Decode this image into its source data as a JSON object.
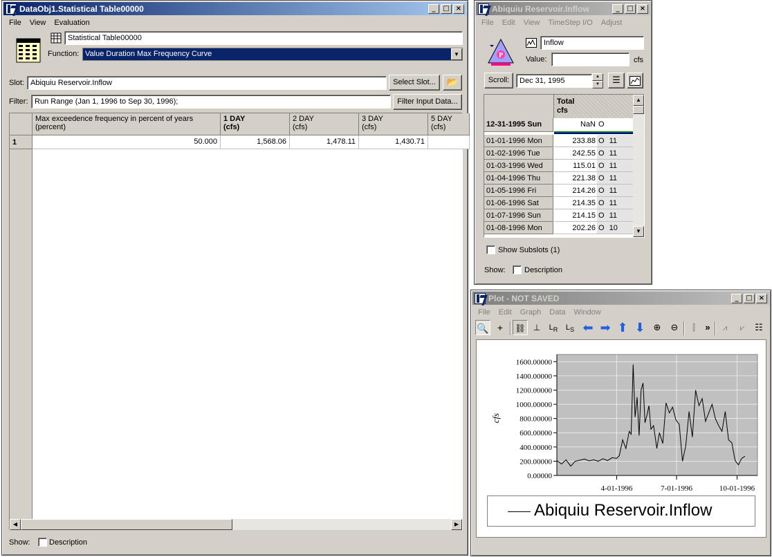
{
  "stat_window": {
    "title": "DataObj1.Statistical Table00000",
    "menu": [
      "File",
      "View",
      "Evaluation"
    ],
    "name_value": "Statistical Table00000",
    "function_label": "Function:",
    "function_value": "Value Duration Max Frequency Curve",
    "slot_label": "Slot:",
    "slot_value": "Abiquiu Reservoir.Inflow",
    "select_slot_label": "Select Slot...",
    "filter_label": "Filter:",
    "filter_value": "Run Range (Jan 1, 1996 to Sep 30, 1996);",
    "filter_button_label": "Filter Input Data...",
    "table": {
      "headers": [
        {
          "line1": "Max exceedence frequency in percent of years",
          "line2": "(percent)"
        },
        {
          "line1": "1 DAY",
          "line2": "(cfs)"
        },
        {
          "line1": "2 DAY",
          "line2": "(cfs)"
        },
        {
          "line1": "3 DAY",
          "line2": "(cfs)"
        },
        {
          "line1": "5 DAY",
          "line2": "(cfs)"
        }
      ],
      "row_number": "1",
      "row_values": [
        "50.000",
        "1,568.06",
        "1,478.11",
        "1,430.71",
        ""
      ]
    },
    "show_label": "Show:",
    "description_label": "Description"
  },
  "slot_window": {
    "title": "Abiquiu Reservoir.Inflow",
    "menu": [
      "File",
      "Edit",
      "View",
      "TimeStep I/O",
      "Adjust"
    ],
    "slot_name": "Inflow",
    "value_label": "Value:",
    "value_input": "",
    "units": "cfs",
    "scroll_label": "Scroll:",
    "scroll_date": "Dec 31, 1995",
    "column_header": {
      "line1": "Total",
      "line2": "cfs"
    },
    "initial_row": {
      "date": "12-31-1995 Sun",
      "value": "NaN",
      "flag": "O",
      "extra": ""
    },
    "rows": [
      {
        "date": "01-01-1996 Mon",
        "value": "233.88",
        "flag": "O",
        "extra": "11"
      },
      {
        "date": "01-02-1996 Tue",
        "value": "242.55",
        "flag": "O",
        "extra": "11"
      },
      {
        "date": "01-03-1996 Wed",
        "value": "115.01",
        "flag": "O",
        "extra": "11"
      },
      {
        "date": "01-04-1996 Thu",
        "value": "221.38",
        "flag": "O",
        "extra": "11"
      },
      {
        "date": "01-05-1996 Fri",
        "value": "214.26",
        "flag": "O",
        "extra": "11"
      },
      {
        "date": "01-06-1996 Sat",
        "value": "214.35",
        "flag": "O",
        "extra": "11"
      },
      {
        "date": "01-07-1996 Sun",
        "value": "214.15",
        "flag": "O",
        "extra": "11"
      },
      {
        "date": "01-08-1996 Mon",
        "value": "202.26",
        "flag": "O",
        "extra": "10"
      }
    ],
    "show_subslots_label": "Show Subslots (1)",
    "show_label": "Show:",
    "description_label": "Description"
  },
  "plot_window": {
    "title": "Plot - NOT SAVED",
    "menu": [
      "File",
      "Edit",
      "Graph",
      "Data",
      "Window"
    ],
    "legend_label": "Abiquiu Reservoir.Inflow"
  },
  "chart_data": {
    "type": "line",
    "title": "",
    "xlabel": "",
    "ylabel": "cfs",
    "ylim": [
      0,
      1700
    ],
    "yticks": [
      "1600.00000",
      "1400.00000",
      "1200.00000",
      "1000.00000",
      "800.00000",
      "600.00000",
      "400.00000",
      "200.00000",
      "0.00000"
    ],
    "ytick_values": [
      1600,
      1400,
      1200,
      1000,
      800,
      600,
      400,
      200,
      0
    ],
    "xlim": [
      "1996-01-01",
      "1996-11-01"
    ],
    "xticks": [
      "4-01-1996",
      "7-01-1996",
      "10-01-1996"
    ],
    "xtick_values": [
      "1996-04-01",
      "1996-07-01",
      "1996-10-01"
    ],
    "grid": true,
    "series": [
      {
        "name": "Abiquiu Reservoir.Inflow",
        "x": [
          "1996-01-01",
          "1996-01-08",
          "1996-01-15",
          "1996-01-22",
          "1996-01-29",
          "1996-02-05",
          "1996-02-12",
          "1996-02-19",
          "1996-02-26",
          "1996-03-04",
          "1996-03-11",
          "1996-03-18",
          "1996-03-25",
          "1996-04-01",
          "1996-04-05",
          "1996-04-10",
          "1996-04-15",
          "1996-04-20",
          "1996-04-23",
          "1996-04-26",
          "1996-04-29",
          "1996-05-02",
          "1996-05-05",
          "1996-05-08",
          "1996-05-11",
          "1996-05-14",
          "1996-05-17",
          "1996-05-20",
          "1996-05-23",
          "1996-05-27",
          "1996-06-01",
          "1996-06-05",
          "1996-06-10",
          "1996-06-15",
          "1996-06-20",
          "1996-06-25",
          "1996-06-30",
          "1996-07-05",
          "1996-07-10",
          "1996-07-15",
          "1996-07-20",
          "1996-07-25",
          "1996-07-30",
          "1996-08-04",
          "1996-08-09",
          "1996-08-14",
          "1996-08-19",
          "1996-08-24",
          "1996-08-29",
          "1996-09-03",
          "1996-09-08",
          "1996-09-13",
          "1996-09-18",
          "1996-09-23",
          "1996-09-28",
          "1996-10-03",
          "1996-10-08",
          "1996-10-13"
        ],
        "values": [
          210,
          160,
          220,
          130,
          200,
          215,
          230,
          205,
          220,
          200,
          235,
          210,
          250,
          240,
          280,
          500,
          380,
          620,
          580,
          1560,
          820,
          1100,
          560,
          1200,
          1300,
          740,
          850,
          980,
          650,
          700,
          380,
          600,
          450,
          1020,
          880,
          960,
          780,
          720,
          200,
          420,
          900,
          540,
          1200,
          980,
          1080,
          760,
          880,
          1000,
          800,
          700,
          620,
          900,
          500,
          460,
          210,
          150,
          240,
          270
        ]
      }
    ]
  }
}
